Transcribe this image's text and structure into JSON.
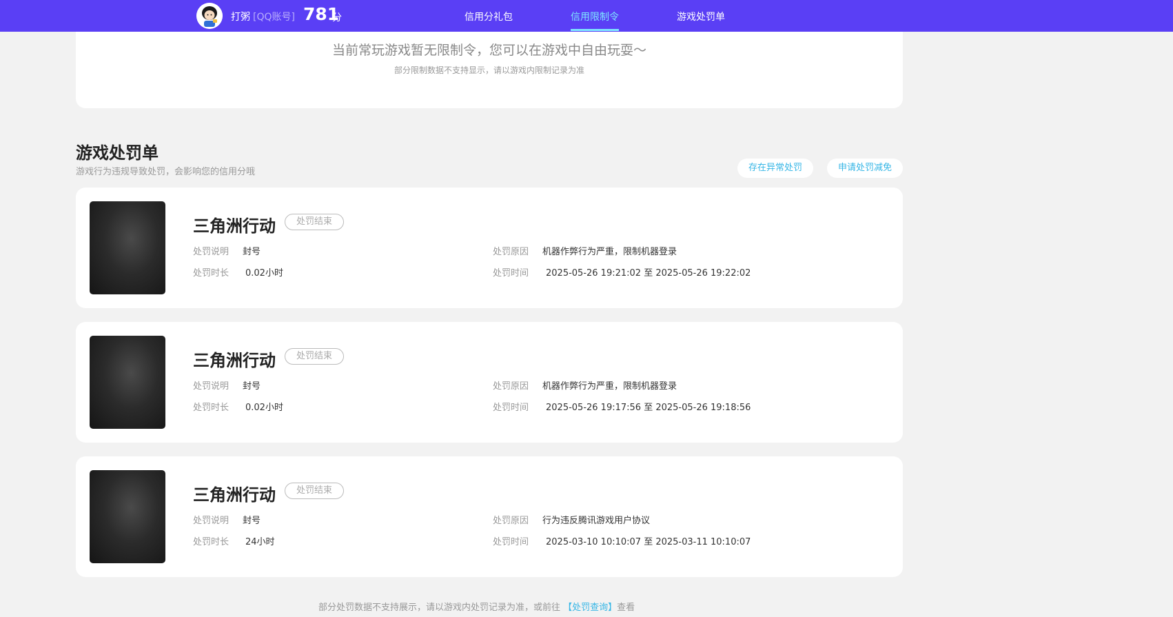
{
  "header": {
    "nickname": "打粥",
    "account_type": "[QQ账号]",
    "score": "781",
    "score_unit": "分",
    "tabs": [
      {
        "label": "信用分礼包",
        "active": false
      },
      {
        "label": "信用限制令",
        "active": true
      },
      {
        "label": "游戏处罚单",
        "active": false
      }
    ]
  },
  "restriction": {
    "main_text": "当前常玩游戏暂无限制令，您可以在游戏中自由玩耍～",
    "sub_text": "部分限制数据不支持显示，请以游戏内限制记录为准"
  },
  "penalty_section": {
    "title": "游戏处罚单",
    "subtitle": "游戏行为违规导致处罚，会影响您的信用分哦",
    "buttons": [
      "存在异常处罚",
      "申请处罚减免"
    ]
  },
  "labels": {
    "desc": "处罚说明",
    "duration": "处罚时长",
    "reason": "处罚原因",
    "time": "处罚时间"
  },
  "penalties": [
    {
      "game": "三角洲行动",
      "status": "处罚结束",
      "desc": "封号",
      "duration": "0.02小时",
      "reason": "机器作弊行为严重，限制机器登录",
      "time": "2025-05-26 19:21:02 至 2025-05-26 19:22:02"
    },
    {
      "game": "三角洲行动",
      "status": "处罚结束",
      "desc": "封号",
      "duration": "0.02小时",
      "reason": "机器作弊行为严重，限制机器登录",
      "time": "2025-05-26 19:17:56 至 2025-05-26 19:18:56"
    },
    {
      "game": "三角洲行动",
      "status": "处罚结束",
      "desc": "封号",
      "duration": "24小时",
      "reason": "行为违反腾讯游戏用户协议",
      "time": "2025-03-10 10:10:07 至 2025-03-11 10:10:07"
    }
  ],
  "footer": {
    "prefix": "部分处罚数据不支持展示，请以游戏内处罚记录为准，或前往 ",
    "link": "【处罚查询】",
    "suffix": "查看"
  },
  "colors": {
    "topbar": "#5a3ff5",
    "active_tab": "#7ee7ff",
    "link": "#36b6e6",
    "background": "#f2f2f2"
  }
}
